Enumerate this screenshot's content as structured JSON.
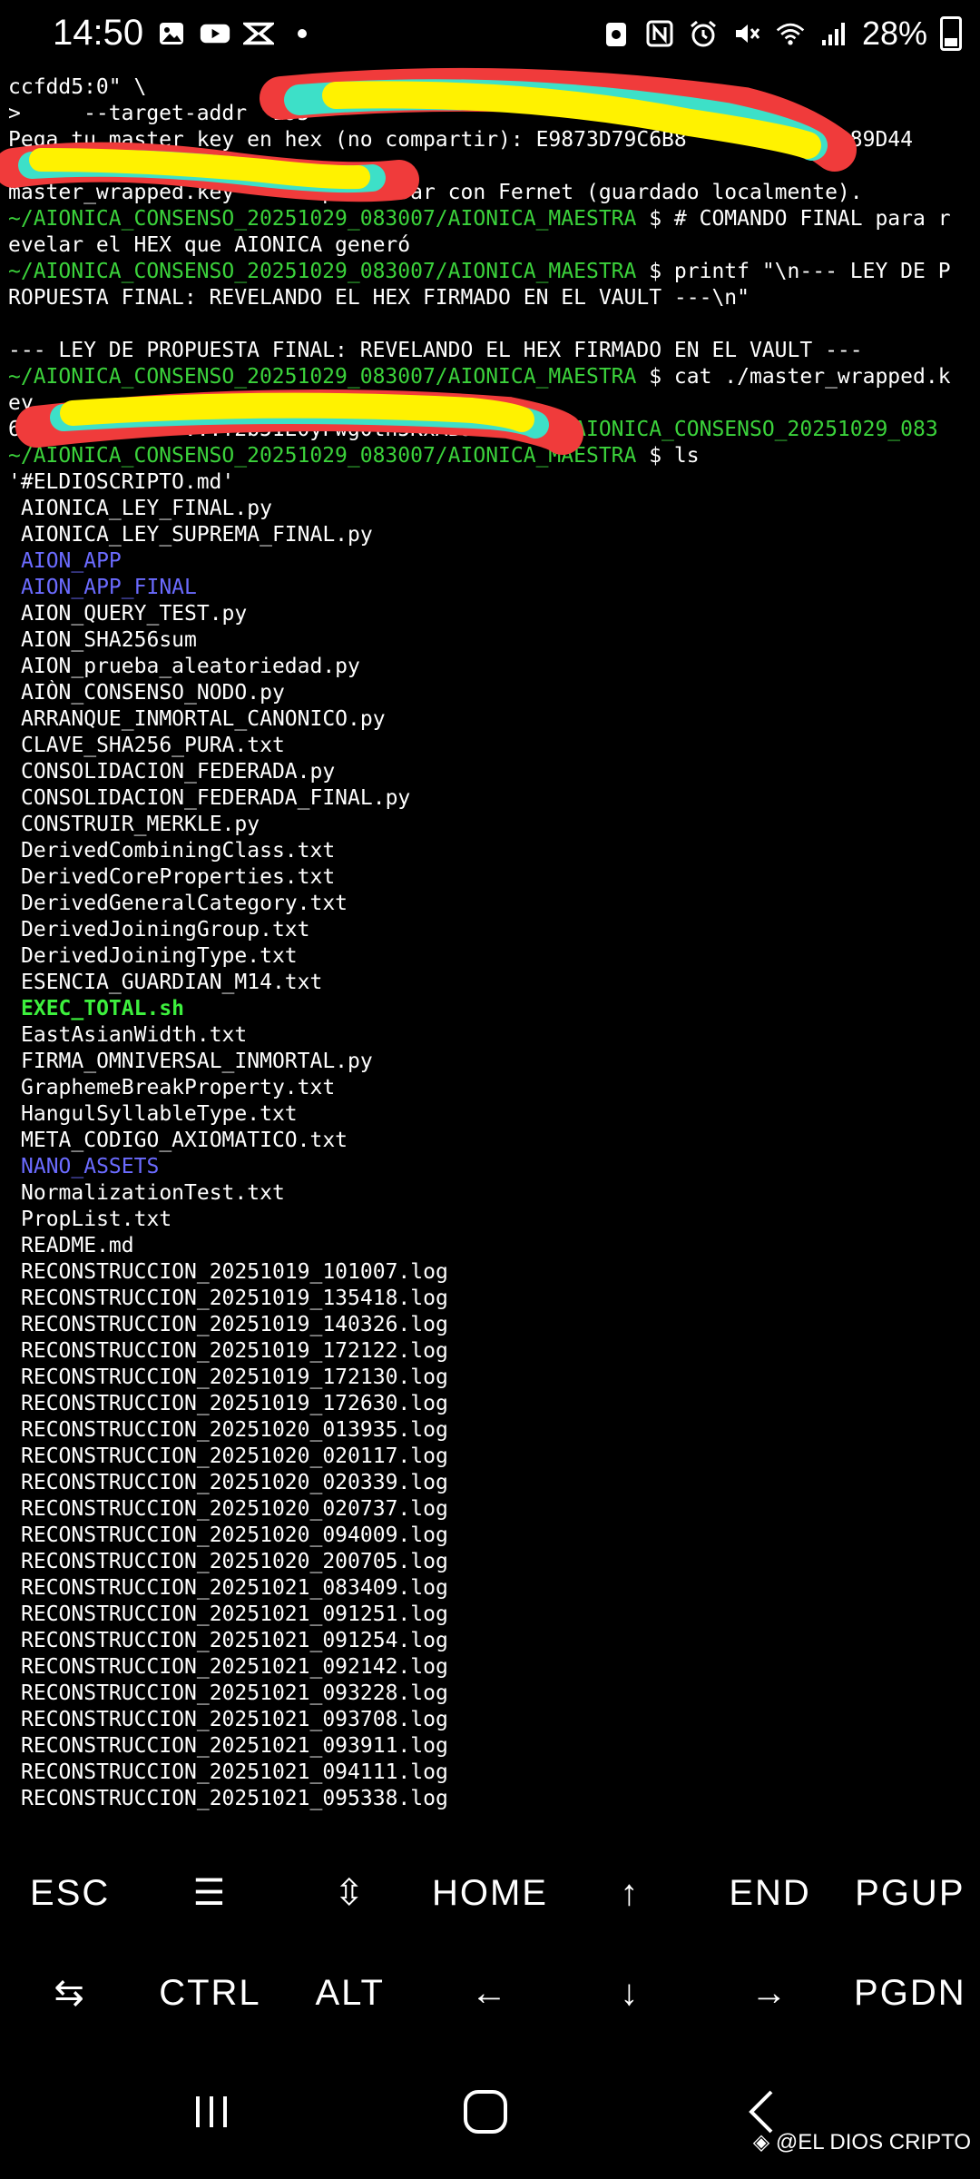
{
  "status_bar": {
    "time": "14:50",
    "battery": "28%",
    "left_icons": [
      "gallery-icon",
      "youtube-icon",
      "app-icon",
      "dot-icon"
    ],
    "right_icons": [
      "recycle-icon",
      "nfc-icon",
      "alarm-icon",
      "mute-icon",
      "wifi-icon",
      "signal-icon"
    ]
  },
  "terminal": {
    "lines": [
      {
        "t": "ccfdd5:0\" \\",
        "c": ""
      },
      {
        "t": ">     --target-addr \"195",
        "c": ""
      },
      {
        "t": "Pega tu master key en hex (no compartir): E9873D79C6B8          33389D44",
        "c": ""
      },
      {
        "t": "5",
        "c": ""
      },
      {
        "t": "master_wrapped.key       para usar con Fernet (guardado localmente).",
        "c": ""
      },
      {
        "p": "~/AIONICA_CONSENSO_20251029_083007/AIONICA_MAESTRA",
        "t": " $ # COMANDO FINAL para r"
      },
      {
        "t": "evelar el HEX que AIONICA generó",
        "c": ""
      },
      {
        "p": "~/AIONICA_CONSENSO_20251029_083007/AIONICA_MAESTRA",
        "t": " $ printf \"\\n--- LEY DE P"
      },
      {
        "t": "ROPUESTA FINAL: REVELANDO EL HEX FIRMADO EN EL VAULT ---\\n\"",
        "c": ""
      },
      {
        "t": "",
        "c": ""
      },
      {
        "t": "--- LEY DE PROPUESTA FINAL: REVELANDO EL HEX FIRMADO EN EL VAULT ---",
        "c": ""
      },
      {
        "p": "~/AIONICA_CONSENSO_20251029_083007/AIONICA_MAESTRA",
        "t": " $ cat ./master_wrapped.k"
      },
      {
        "t": "ey",
        "c": ""
      },
      {
        "t": "6Y            ...T2b51E0yFwg0th5KxAB9505HX6",
        "g": "~/AIONICA_CONSENSO_20251029_083"
      },
      {
        "p": "~/AIONICA_CONSENSO_20251029_083007/AIONICA_MAESTRA",
        "t": " $ ls"
      }
    ],
    "files": [
      {
        "name": "'#ELDIOSCRIPTO.md'",
        "type": "file",
        "noindent": true
      },
      {
        "name": "AIONICA_LEY_FINAL.py",
        "type": "file"
      },
      {
        "name": "AIONICA_LEY_SUPREMA_FINAL.py",
        "type": "file"
      },
      {
        "name": "AION_APP",
        "type": "dir"
      },
      {
        "name": "AION_APP_FINAL",
        "type": "dir"
      },
      {
        "name": "AION_QUERY_TEST.py",
        "type": "file"
      },
      {
        "name": "AION_SHA256sum",
        "type": "file"
      },
      {
        "name": "AION_prueba_aleatoriedad.py",
        "type": "file"
      },
      {
        "name": "AIÒN_CONSENSO_NODO.py",
        "type": "file"
      },
      {
        "name": "ARRANQUE_INMORTAL_CANONICO.py",
        "type": "file"
      },
      {
        "name": "CLAVE_SHA256_PURA.txt",
        "type": "file"
      },
      {
        "name": "CONSOLIDACION_FEDERADA.py",
        "type": "file"
      },
      {
        "name": "CONSOLIDACION_FEDERADA_FINAL.py",
        "type": "file"
      },
      {
        "name": "CONSTRUIR_MERKLE.py",
        "type": "file"
      },
      {
        "name": "DerivedCombiningClass.txt",
        "type": "file"
      },
      {
        "name": "DerivedCoreProperties.txt",
        "type": "file"
      },
      {
        "name": "DerivedGeneralCategory.txt",
        "type": "file"
      },
      {
        "name": "DerivedJoiningGroup.txt",
        "type": "file"
      },
      {
        "name": "DerivedJoiningType.txt",
        "type": "file"
      },
      {
        "name": "ESENCIA_GUARDIAN_M14.txt",
        "type": "file"
      },
      {
        "name": "EXEC_TOTAL.sh",
        "type": "exec"
      },
      {
        "name": "EastAsianWidth.txt",
        "type": "file"
      },
      {
        "name": "FIRMA_OMNIVERSAL_INMORTAL.py",
        "type": "file"
      },
      {
        "name": "GraphemeBreakProperty.txt",
        "type": "file"
      },
      {
        "name": "HangulSyllableType.txt",
        "type": "file"
      },
      {
        "name": "META_CODIGO_AXIOMATICO.txt",
        "type": "file"
      },
      {
        "name": "NANO_ASSETS",
        "type": "dir"
      },
      {
        "name": "NormalizationTest.txt",
        "type": "file"
      },
      {
        "name": "PropList.txt",
        "type": "file"
      },
      {
        "name": "README.md",
        "type": "file"
      },
      {
        "name": "RECONSTRUCCION_20251019_101007.log",
        "type": "file"
      },
      {
        "name": "RECONSTRUCCION_20251019_135418.log",
        "type": "file"
      },
      {
        "name": "RECONSTRUCCION_20251019_140326.log",
        "type": "file"
      },
      {
        "name": "RECONSTRUCCION_20251019_172122.log",
        "type": "file"
      },
      {
        "name": "RECONSTRUCCION_20251019_172130.log",
        "type": "file"
      },
      {
        "name": "RECONSTRUCCION_20251019_172630.log",
        "type": "file"
      },
      {
        "name": "RECONSTRUCCION_20251020_013935.log",
        "type": "file"
      },
      {
        "name": "RECONSTRUCCION_20251020_020117.log",
        "type": "file"
      },
      {
        "name": "RECONSTRUCCION_20251020_020339.log",
        "type": "file"
      },
      {
        "name": "RECONSTRUCCION_20251020_020737.log",
        "type": "file"
      },
      {
        "name": "RECONSTRUCCION_20251020_094009.log",
        "type": "file"
      },
      {
        "name": "RECONSTRUCCION_20251020_200705.log",
        "type": "file"
      },
      {
        "name": "RECONSTRUCCION_20251021_083409.log",
        "type": "file"
      },
      {
        "name": "RECONSTRUCCION_20251021_091251.log",
        "type": "file"
      },
      {
        "name": "RECONSTRUCCION_20251021_091254.log",
        "type": "file"
      },
      {
        "name": "RECONSTRUCCION_20251021_092142.log",
        "type": "file"
      },
      {
        "name": "RECONSTRUCCION_20251021_093228.log",
        "type": "file"
      },
      {
        "name": "RECONSTRUCCION_20251021_093708.log",
        "type": "file"
      },
      {
        "name": "RECONSTRUCCION_20251021_093911.log",
        "type": "file"
      },
      {
        "name": "RECONSTRUCCION_20251021_094111.log",
        "type": "file"
      },
      {
        "name": "RECONSTRUCCION_20251021_095338.log",
        "type": "file"
      }
    ]
  },
  "extra_keys": {
    "row1": [
      "ESC",
      "☰",
      "⇳",
      "HOME",
      "↑",
      "END",
      "PGUP"
    ],
    "row2": [
      "⇆",
      "CTRL",
      "ALT",
      "←",
      "↓",
      "→",
      "PGDN"
    ]
  },
  "nav_bar": {
    "buttons": [
      "recents-icon",
      "home-icon",
      "back-icon"
    ]
  },
  "watermark": "@EL DIOS CRIPTO",
  "colors": {
    "background": "#000000",
    "prompt_green": "#3bd23b",
    "dir_blue": "#6b6bff",
    "exec_green": "#3df03d",
    "redact_red": "#f03b3b",
    "redact_cyan": "#3de0c8",
    "redact_yellow": "#fff200"
  }
}
